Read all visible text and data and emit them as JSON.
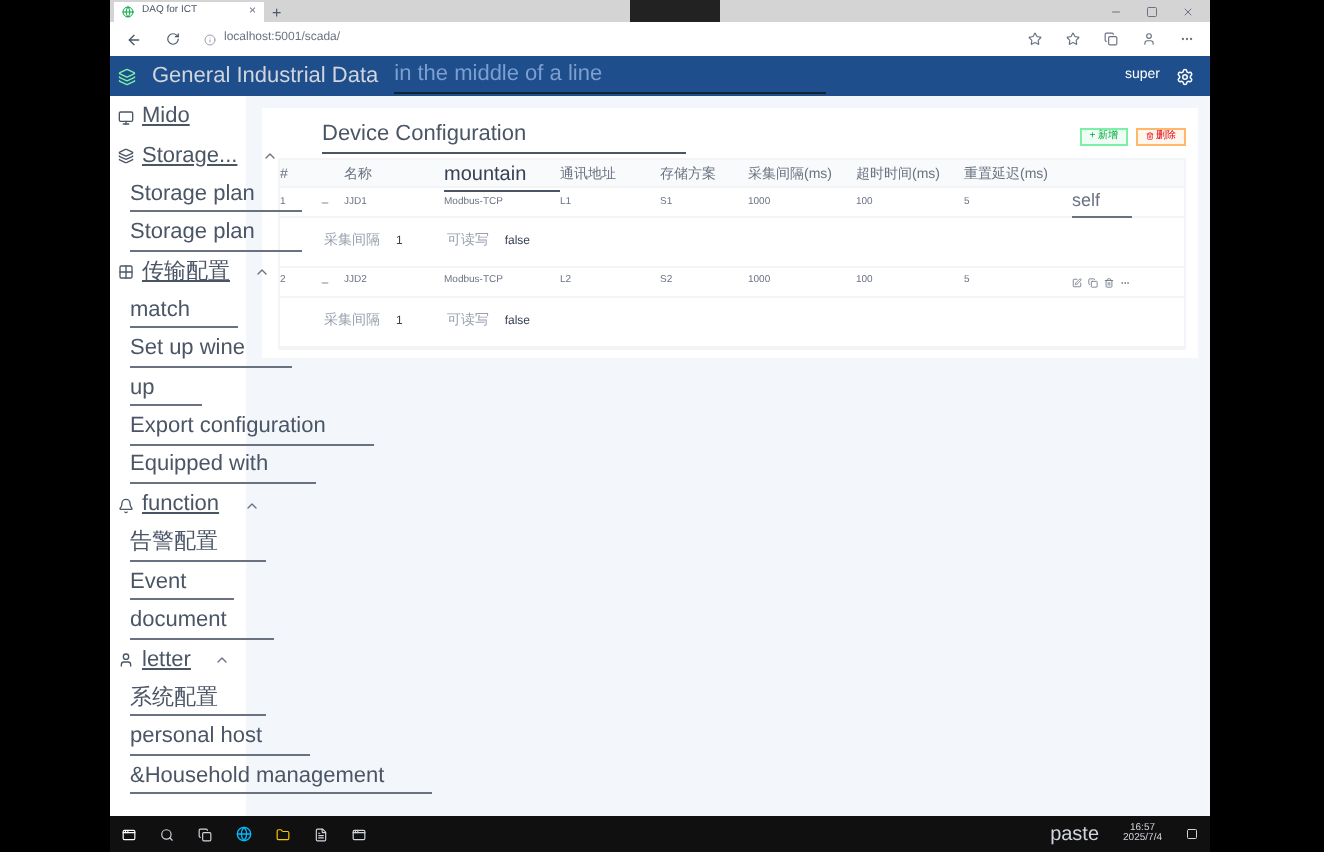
{
  "browser": {
    "tab_title": "DAQ for ICT",
    "tab_close": "×",
    "new_tab": "+",
    "url": "localhost:5001/scada/"
  },
  "header": {
    "title": "General Industrial Data",
    "overlay": "in the middle of a line",
    "user": "super"
  },
  "sidebar": {
    "items": [
      {
        "label": "Mido",
        "kind": "item"
      },
      {
        "label": "Storage...",
        "kind": "group",
        "expanded": true,
        "children": [
          {
            "label": "Storage plan"
          },
          {
            "label": "Storage plan"
          }
        ]
      },
      {
        "label": "传输配置",
        "kind": "group",
        "expanded": true,
        "children": [
          {
            "label": "match"
          },
          {
            "label": "Set up wine"
          },
          {
            "label": "up"
          },
          {
            "label": "Export configuration"
          },
          {
            "label": "Equipped with"
          }
        ]
      },
      {
        "label": "function",
        "kind": "group",
        "expanded": true,
        "children": [
          {
            "label": "告警配置"
          },
          {
            "label": "Event"
          },
          {
            "label": "document"
          }
        ]
      },
      {
        "label": "letter",
        "kind": "group",
        "expanded": true,
        "children": [
          {
            "label": "系统配置"
          },
          {
            "label": "personal host"
          },
          {
            "label": "&Household management"
          }
        ]
      }
    ]
  },
  "page": {
    "title": "Device Configuration",
    "add_button": "+ 新增",
    "delete_button": "删除",
    "columns": [
      "#",
      "",
      "名称",
      "mountain",
      "通讯地址",
      "存储方案",
      "采集间隔(ms)",
      "超时时间(ms)",
      "重置延迟(ms)",
      ""
    ],
    "rows": [
      {
        "cells": [
          "1",
          "",
          "JJD1",
          "Modbus-TCP",
          "L1",
          "S1",
          "1000",
          "100",
          "5"
        ],
        "expanded": true,
        "action_text": "self",
        "detail": [
          "采集间隔",
          "1",
          "可读写",
          "false"
        ]
      },
      {
        "cells": [
          "2",
          "",
          "JJD2",
          "Modbus-TCP",
          "L2",
          "S2",
          "1000",
          "100",
          "5"
        ],
        "expanded": true,
        "detail": [
          "采集间隔",
          "1",
          "可读写",
          "false"
        ]
      }
    ]
  },
  "taskbar": {
    "tray_text": "paste",
    "time": "16:57",
    "date": "2025/7/4"
  }
}
